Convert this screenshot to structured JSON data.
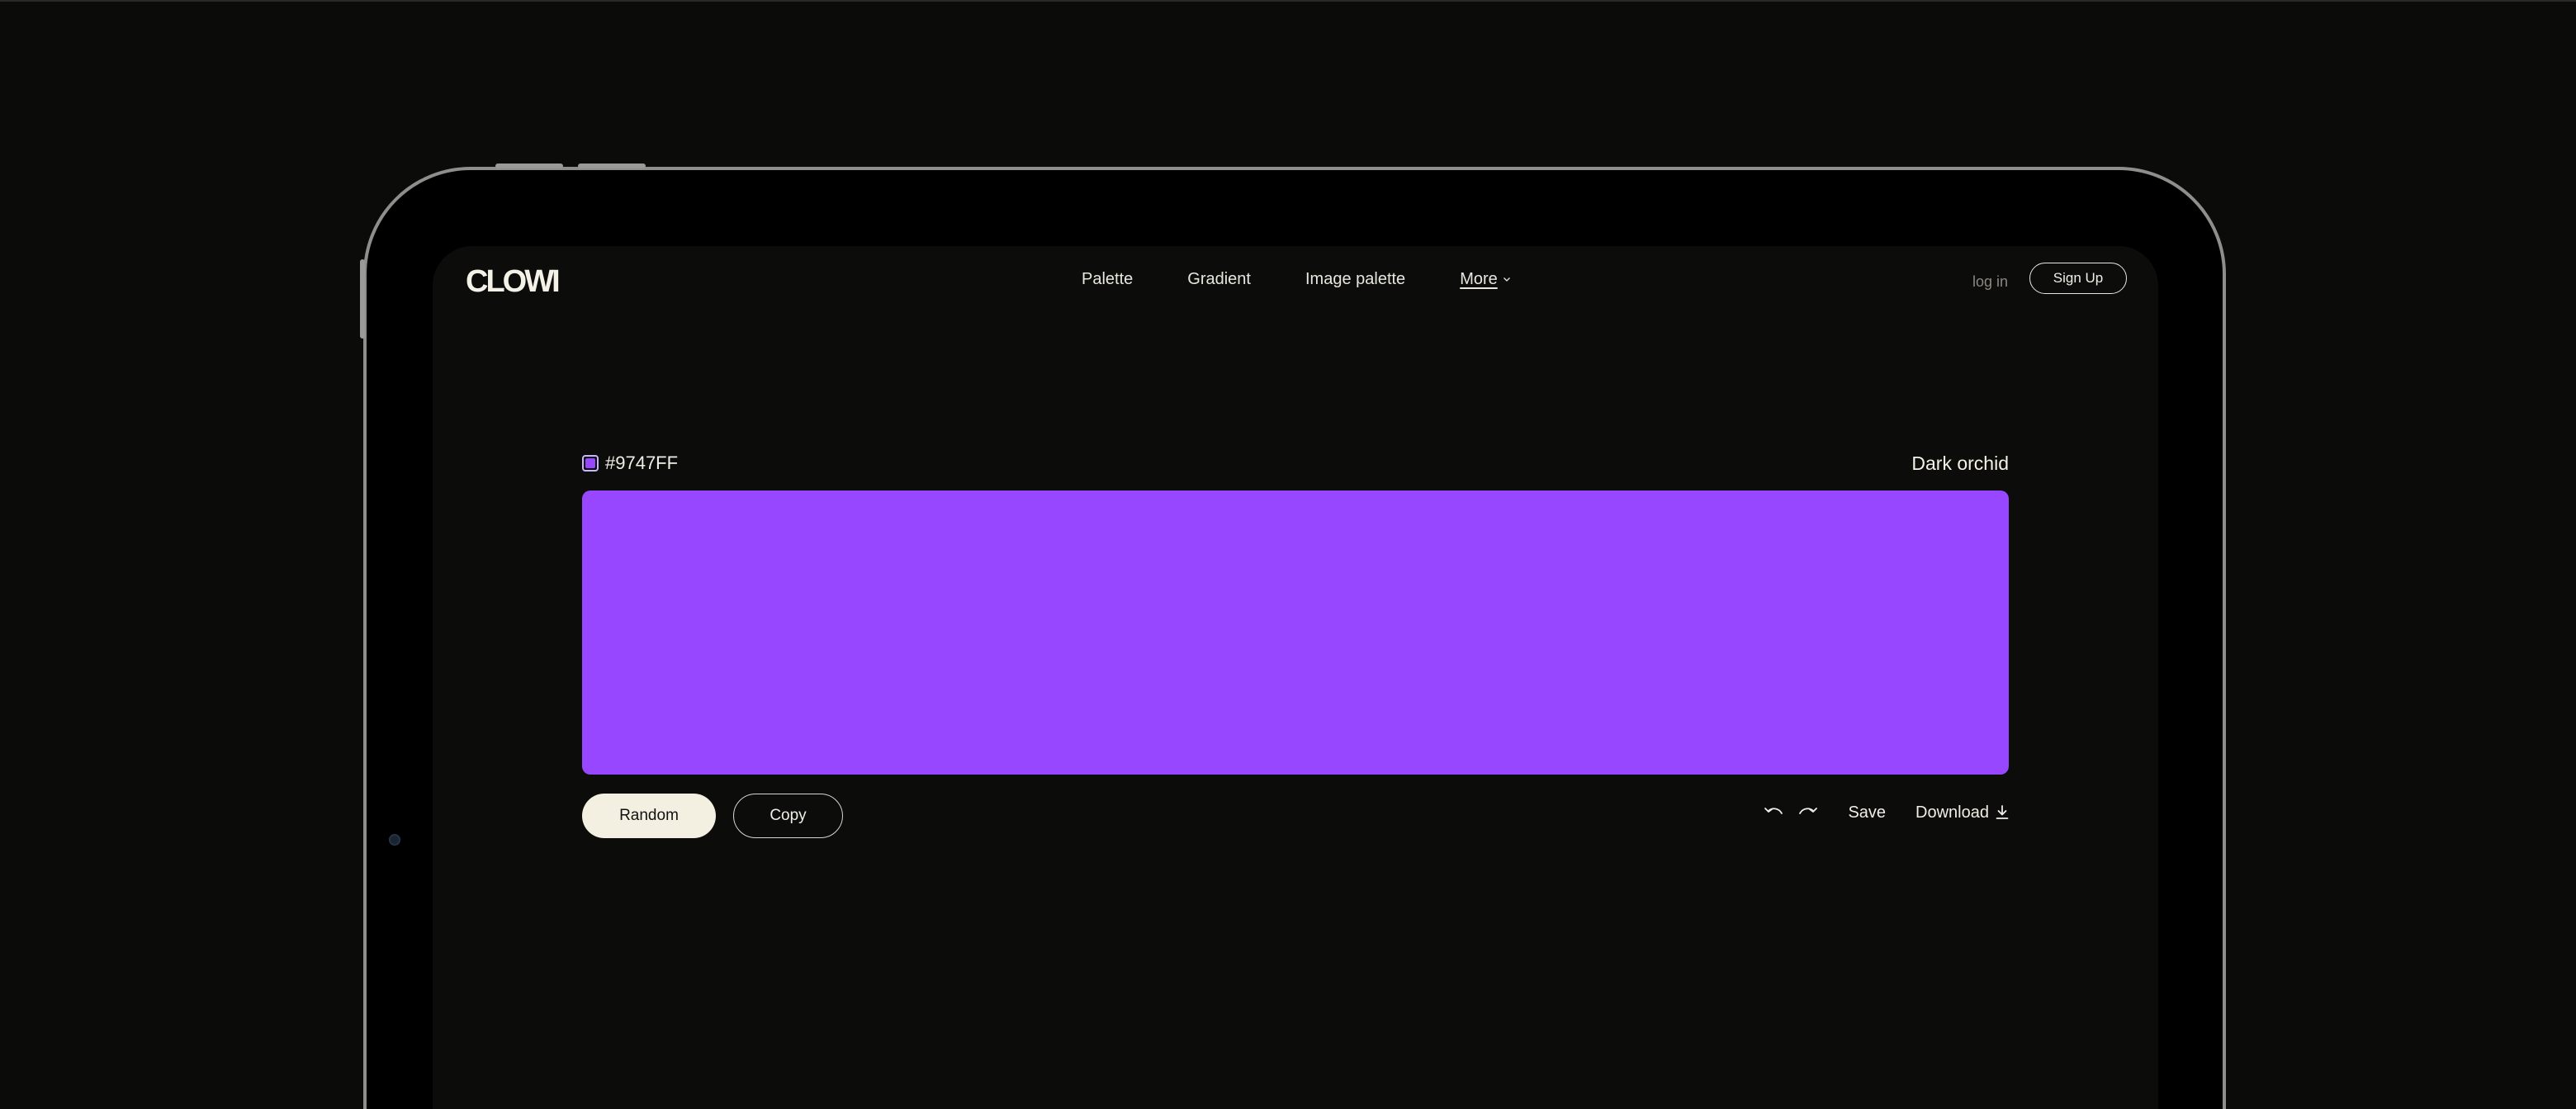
{
  "brand": {
    "logo_text": "CLOWI"
  },
  "nav": {
    "items": [
      {
        "label": "Palette"
      },
      {
        "label": "Gradient"
      },
      {
        "label": "Image palette"
      }
    ],
    "more_label": "More"
  },
  "auth": {
    "login_label": "log in",
    "signup_label": "Sign Up"
  },
  "color": {
    "hex": "#9747FF",
    "name": "Dark orchid",
    "value": "#9747FF"
  },
  "actions": {
    "random_label": "Random",
    "copy_label": "Copy",
    "save_label": "Save",
    "download_label": "Download",
    "undo_icon": "undo-icon",
    "redo_icon": "redo-icon",
    "download_icon": "download-icon"
  },
  "theme": {
    "background": "#0c0c0a",
    "text": "#f0eee6",
    "random_button_bg": "#f3f0e2"
  }
}
